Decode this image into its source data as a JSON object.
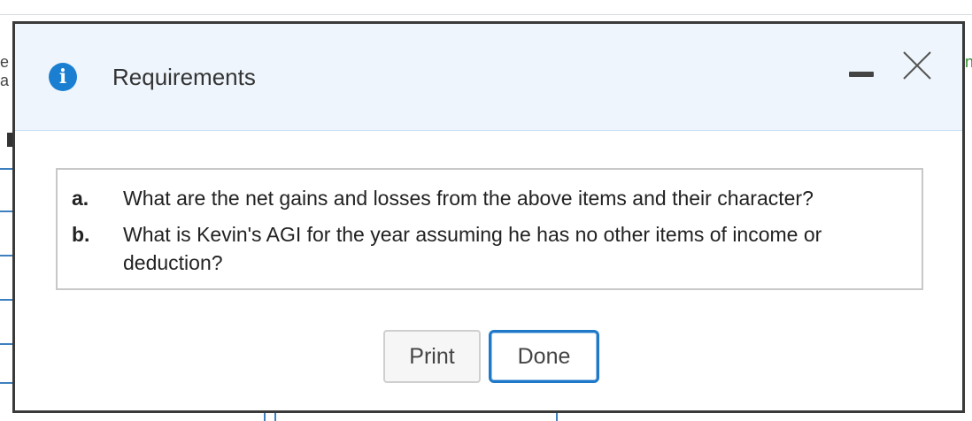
{
  "dialog": {
    "title": "Requirements",
    "icon": "info-icon",
    "accent_color": "#1a7fd1"
  },
  "requirements": [
    {
      "letter": "a.",
      "text": "What are the net gains and losses from the above items and their character?"
    },
    {
      "letter": "b.",
      "text": "What is Kevin's AGI for the year assuming he has no other items of income or deduction?"
    }
  ],
  "buttons": {
    "print_label": "Print",
    "done_label": "Done"
  }
}
